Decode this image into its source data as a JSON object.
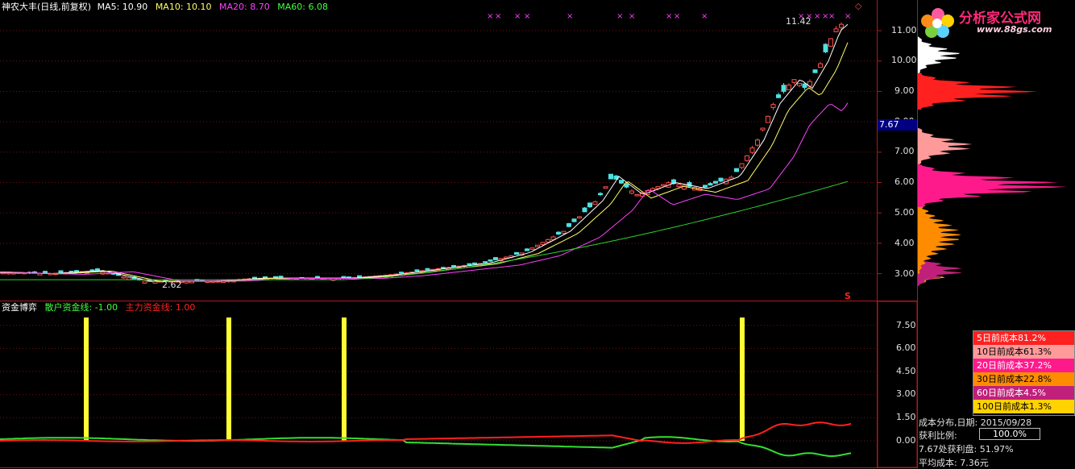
{
  "header": {
    "stock_title": "神农大丰(日线,前复权)",
    "ma_items": [
      {
        "label": "MA5: 10.90",
        "color": "#ffffff"
      },
      {
        "label": "MA10: 10.10",
        "color": "#ffff66"
      },
      {
        "label": "MA20: 8.70",
        "color": "#ff40ff"
      },
      {
        "label": "MA60: 6.08",
        "color": "#40ff40"
      }
    ]
  },
  "price_axis": {
    "ticks": [
      "11.00",
      "10.00",
      "9.00",
      "8.00",
      "7.00",
      "6.00",
      "5.00",
      "4.00",
      "3.00"
    ],
    "current_price": "7.67"
  },
  "annotations": {
    "high_label": "11.42",
    "low_label": "2.62",
    "s_marker": "S",
    "diamond": "◇"
  },
  "indicator": {
    "name": "资金博弈",
    "retail_label": "散户资金线: -1.00",
    "main_label": "主力资金线: 1.00",
    "retail_color": "#40ff40",
    "main_color": "#ff2020",
    "ticks": [
      "7.50",
      "6.00",
      "4.50",
      "3.00",
      "1.50",
      "0.00"
    ]
  },
  "cost_legend": [
    {
      "label": "5日前成本81.2%",
      "bg": "#ff2020",
      "fg": "#ffffff"
    },
    {
      "label": "10日前成本61.3%",
      "bg": "#ff9a9a",
      "fg": "#000000"
    },
    {
      "label": "20日前成本37.2%",
      "bg": "#ff1a8c",
      "fg": "#ffffff"
    },
    {
      "label": "30日前成本22.8%",
      "bg": "#ff8c00",
      "fg": "#000000"
    },
    {
      "label": "60日前成本4.5%",
      "bg": "#c0207a",
      "fg": "#ffffff"
    },
    {
      "label": "100日前成本1.3%",
      "bg": "#ffd200",
      "fg": "#000000"
    }
  ],
  "cost_info": {
    "dist_date": "成本分布,日期:  2015/09/28",
    "ratio_label": "获利比例:",
    "ratio_value": "100.0%",
    "profit_line": "7.67处获利盘:  51.97%",
    "avg_cost": "平均成本:  7.36元"
  },
  "logo": {
    "text": "分析家公式网",
    "url": "www.88gs.com"
  }
}
